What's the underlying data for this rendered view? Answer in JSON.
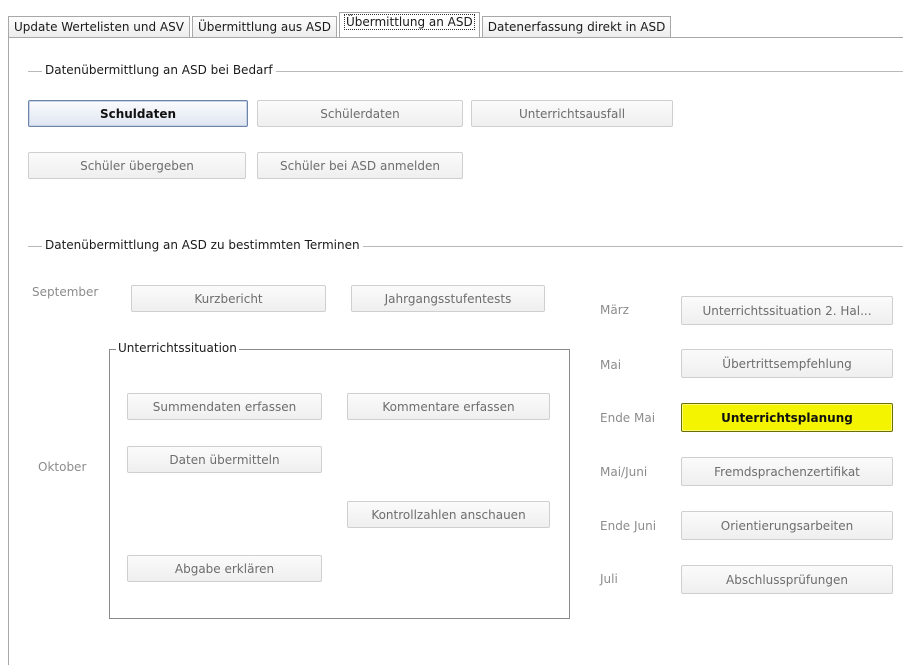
{
  "tabs": [
    {
      "label": "Update Wertelisten und ASV"
    },
    {
      "label": "Übermittlung aus ASD"
    },
    {
      "label": "Übermittlung an ASD"
    },
    {
      "label": "Datenerfassung direkt in ASD"
    }
  ],
  "bedarf": {
    "title": "Datenübermittlung an ASD bei Bedarf",
    "buttons": {
      "schuldaten": "Schuldaten",
      "schuelerdaten": "Schülerdaten",
      "unterrichtsausfall": "Unterrichtsausfall",
      "schueler_uebergeben": "Schüler übergeben",
      "schueler_anmelden": "Schüler bei ASD anmelden"
    }
  },
  "termine": {
    "title": "Datenübermittlung an ASD zu bestimmten Terminen",
    "months": {
      "september": "September",
      "oktober": "Oktober",
      "maerz": "März",
      "mai": "Mai",
      "ende_mai": "Ende Mai",
      "mai_juni": "Mai/Juni",
      "ende_juni": "Ende Juni",
      "juli": "Juli"
    },
    "buttons": {
      "kurzbericht": "Kurzbericht",
      "jahrgangsstufentests": "Jahrgangsstufentests",
      "unterrichtssituation2": "Unterrichtssituation 2. Hal...",
      "uebertrittsempfehlung": "Übertrittsempfehlung",
      "unterrichtsplanung": "Unterrichtsplanung",
      "fremdsprachenzertifikat": "Fremdsprachenzertifikat",
      "orientierungsarbeiten": "Orientierungsarbeiten",
      "abschlusspruefungen": "Abschlussprüfungen"
    },
    "unterrichtssituation": {
      "title": "Unterrichtssituation",
      "summendaten": "Summendaten erfassen",
      "kommentare": "Kommentare erfassen",
      "daten_uebermitteln": "Daten übermitteln",
      "kontrollzahlen": "Kontrollzahlen anschauen",
      "abgabe": "Abgabe erklären"
    }
  },
  "colors": {
    "highlight_button": "#f4f400",
    "primary_button_border": "#6d83a8"
  }
}
